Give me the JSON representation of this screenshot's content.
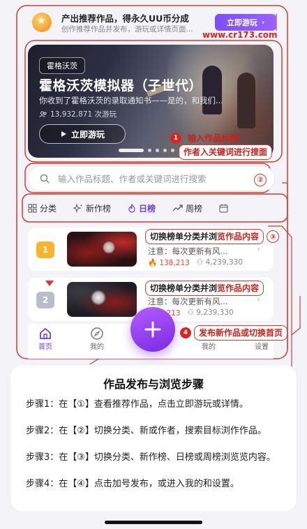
{
  "promo": {
    "title": "产出推荐作品，得永久UU币分成",
    "subtitle": "创作推荐作品并发布，游玩或详情页面...",
    "button": "立即游玩",
    "url": "www.cr173.com"
  },
  "hero": {
    "tag": "霍格沃茨",
    "title": "霍格沃茨模拟器（子世代）",
    "description": "你收到了霍格沃茨的录取通知书——是的，和我们...",
    "plays": "13,932,871 次游玩",
    "button": "立即游玩"
  },
  "search": {
    "placeholder": "输入作品标题、作者或关键词进行搜索"
  },
  "tabs": [
    {
      "label": "分类",
      "icon": "grid-icon"
    },
    {
      "label": "新作榜",
      "icon": "sparkle-icon"
    },
    {
      "label": "日榜",
      "icon": "flame-icon",
      "active": true
    },
    {
      "label": "周榜",
      "icon": "trend-icon"
    },
    {
      "label": "",
      "icon": "calendar-icon"
    }
  ],
  "list": [
    {
      "rank": "1",
      "rank_color": "#f7b52b",
      "title": "注意：每次更新有风...",
      "hot": "138,213",
      "plays": "4,239,330"
    },
    {
      "rank": "2",
      "rank_color": "#b9bdc9",
      "title": "注意：每次更新有风...",
      "hot": "1,213",
      "plays": "9,239,330"
    }
  ],
  "nav": [
    {
      "label": "首页",
      "icon": "home-icon",
      "active": true
    },
    {
      "label": "我的",
      "icon": "compass-icon"
    },
    {
      "label": "我的",
      "icon": "user-icon"
    },
    {
      "label": "设置",
      "icon": "settings-icon"
    }
  ],
  "callouts": {
    "c1_line1": "输入作品标题、",
    "c1_line2": "作者入关键词进行搜面",
    "c2": "②",
    "c3_dark": "切换榜单分类并浏",
    "c3_red": "览作品内容",
    "c3_num": "③",
    "c4_dark": "切换榜单分类并浏",
    "c4_red": "览作品内容",
    "c5": "发布新作品或切换首页",
    "n1": "1",
    "n2": "2",
    "n4": "4"
  },
  "guide": {
    "title": "作品发布与浏览步骤",
    "steps": [
      {
        "num": "①",
        "text": "步骤1：在【①】查看推荐作品，点击立即游玩或详情。"
      },
      {
        "num": "②",
        "text": "步骤2：在【②】切换分类、新或作者，搜索目标浏作作品。"
      },
      {
        "num": "③",
        "text": "步骤3：在【③】切换分类、新作榜、日榜或周榜浏览览内容。"
      },
      {
        "num": "④",
        "text": "步骤4：在【④】点击加号发布，或进入我的和设置。"
      }
    ]
  },
  "colors": {
    "accent": "#6c3df0",
    "annotation": "#d33a33",
    "hot": "#e34a2c"
  }
}
